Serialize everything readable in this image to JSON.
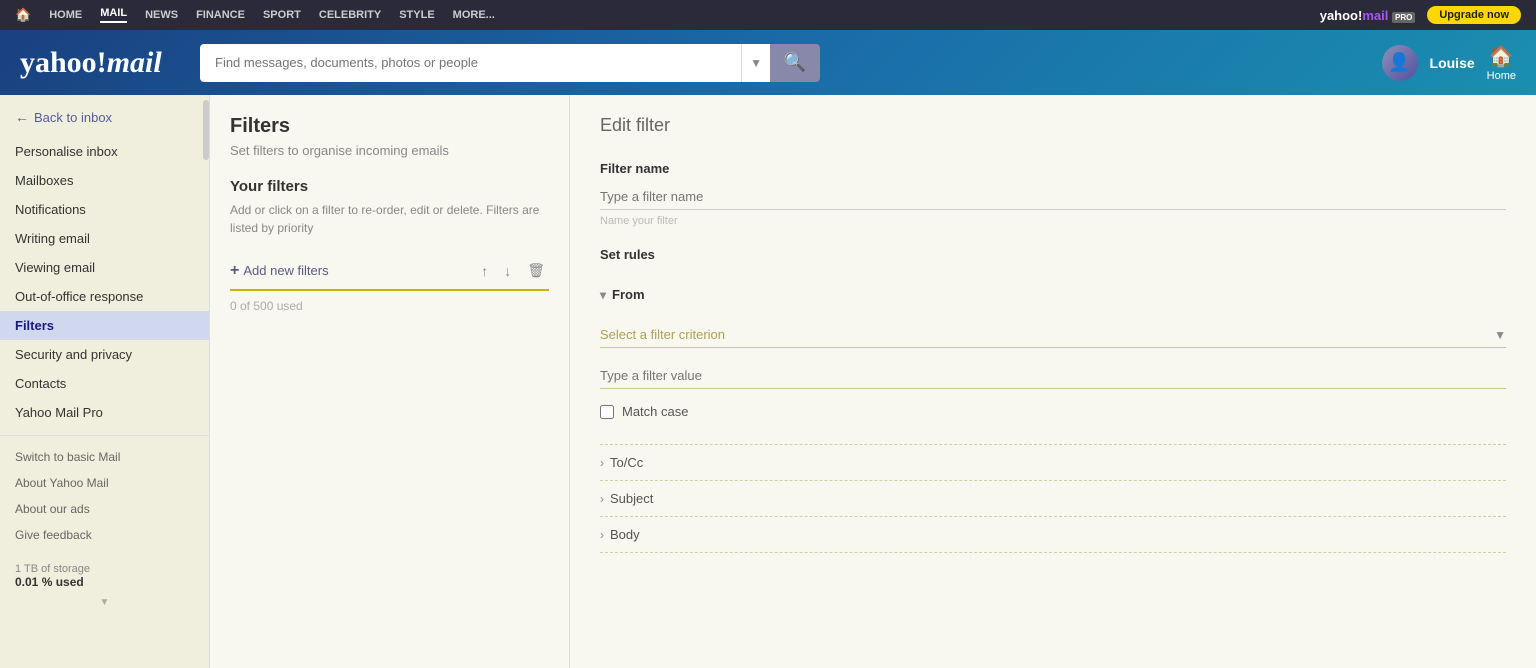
{
  "topnav": {
    "items": [
      {
        "label": "HOME",
        "active": false
      },
      {
        "label": "MAIL",
        "active": true
      },
      {
        "label": "NEWS",
        "active": false
      },
      {
        "label": "FINANCE",
        "active": false
      },
      {
        "label": "SPORT",
        "active": false
      },
      {
        "label": "CELEBRITY",
        "active": false
      },
      {
        "label": "STYLE",
        "active": false
      },
      {
        "label": "MORE...",
        "active": false
      }
    ],
    "logo_right": "yahoo!mail",
    "upgrade_btn": "Upgrade now"
  },
  "header": {
    "logo": "yahoo!mail",
    "search_placeholder": "Find messages, documents, photos or people",
    "user_name": "Louise",
    "home_label": "Home"
  },
  "sidebar": {
    "back_label": "Back to inbox",
    "nav_items": [
      {
        "label": "Personalise inbox",
        "active": false
      },
      {
        "label": "Mailboxes",
        "active": false
      },
      {
        "label": "Notifications",
        "active": false
      },
      {
        "label": "Writing email",
        "active": false
      },
      {
        "label": "Viewing email",
        "active": false
      },
      {
        "label": "Out-of-office response",
        "active": false
      },
      {
        "label": "Filters",
        "active": true
      },
      {
        "label": "Security and privacy",
        "active": false
      },
      {
        "label": "Contacts",
        "active": false
      },
      {
        "label": "Yahoo Mail Pro",
        "active": false
      }
    ],
    "footer_items": [
      {
        "label": "Switch to basic Mail"
      },
      {
        "label": "About Yahoo Mail"
      },
      {
        "label": "About our ads"
      },
      {
        "label": "Give feedback"
      }
    ],
    "storage_text": "1 TB of storage",
    "storage_used": "0.01 % used"
  },
  "filters": {
    "title": "Filters",
    "subtitle": "Set filters to organise incoming emails",
    "your_filters_title": "Your filters",
    "your_filters_desc": "Add or click on a filter to re-order, edit or delete. Filters are listed by priority",
    "add_filter_label": "Add new filters",
    "used_label": "0 of 500 used"
  },
  "edit_filter": {
    "title": "Edit filter",
    "filter_name_label": "Filter name",
    "filter_name_placeholder": "Type a filter name",
    "filter_name_hint": "Name your filter",
    "set_rules_label": "Set rules",
    "from_section": {
      "label": "From",
      "expanded": true,
      "criterion_placeholder": "Select a filter criterion",
      "value_placeholder": "Type a filter value",
      "match_case_label": "Match case"
    },
    "to_cc_section": {
      "label": "To/Cc",
      "expanded": false
    },
    "subject_section": {
      "label": "Subject",
      "expanded": false
    },
    "body_section": {
      "label": "Body",
      "expanded": false
    }
  }
}
